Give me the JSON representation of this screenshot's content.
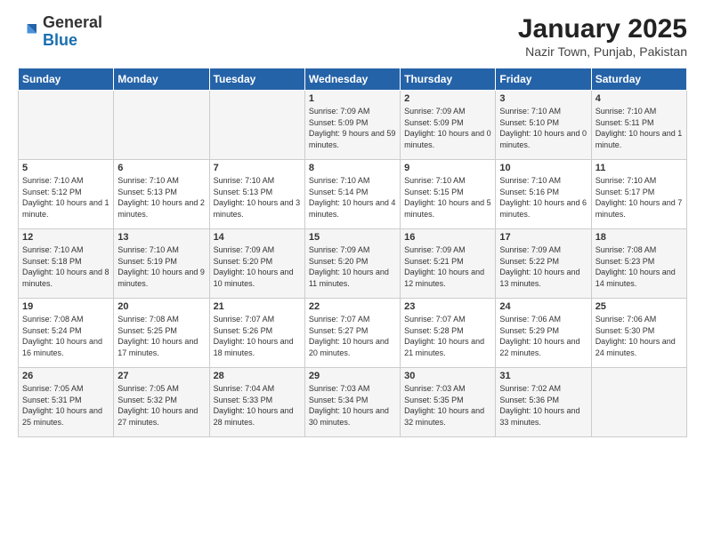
{
  "header": {
    "logo_line1": "General",
    "logo_line2": "Blue",
    "title": "January 2025",
    "subtitle": "Nazir Town, Punjab, Pakistan"
  },
  "days_of_week": [
    "Sunday",
    "Monday",
    "Tuesday",
    "Wednesday",
    "Thursday",
    "Friday",
    "Saturday"
  ],
  "weeks": [
    [
      {
        "day": "",
        "text": ""
      },
      {
        "day": "",
        "text": ""
      },
      {
        "day": "",
        "text": ""
      },
      {
        "day": "1",
        "text": "Sunrise: 7:09 AM\nSunset: 5:09 PM\nDaylight: 9 hours and 59 minutes."
      },
      {
        "day": "2",
        "text": "Sunrise: 7:09 AM\nSunset: 5:09 PM\nDaylight: 10 hours and 0 minutes."
      },
      {
        "day": "3",
        "text": "Sunrise: 7:10 AM\nSunset: 5:10 PM\nDaylight: 10 hours and 0 minutes."
      },
      {
        "day": "4",
        "text": "Sunrise: 7:10 AM\nSunset: 5:11 PM\nDaylight: 10 hours and 1 minute."
      }
    ],
    [
      {
        "day": "5",
        "text": "Sunrise: 7:10 AM\nSunset: 5:12 PM\nDaylight: 10 hours and 1 minute."
      },
      {
        "day": "6",
        "text": "Sunrise: 7:10 AM\nSunset: 5:13 PM\nDaylight: 10 hours and 2 minutes."
      },
      {
        "day": "7",
        "text": "Sunrise: 7:10 AM\nSunset: 5:13 PM\nDaylight: 10 hours and 3 minutes."
      },
      {
        "day": "8",
        "text": "Sunrise: 7:10 AM\nSunset: 5:14 PM\nDaylight: 10 hours and 4 minutes."
      },
      {
        "day": "9",
        "text": "Sunrise: 7:10 AM\nSunset: 5:15 PM\nDaylight: 10 hours and 5 minutes."
      },
      {
        "day": "10",
        "text": "Sunrise: 7:10 AM\nSunset: 5:16 PM\nDaylight: 10 hours and 6 minutes."
      },
      {
        "day": "11",
        "text": "Sunrise: 7:10 AM\nSunset: 5:17 PM\nDaylight: 10 hours and 7 minutes."
      }
    ],
    [
      {
        "day": "12",
        "text": "Sunrise: 7:10 AM\nSunset: 5:18 PM\nDaylight: 10 hours and 8 minutes."
      },
      {
        "day": "13",
        "text": "Sunrise: 7:10 AM\nSunset: 5:19 PM\nDaylight: 10 hours and 9 minutes."
      },
      {
        "day": "14",
        "text": "Sunrise: 7:09 AM\nSunset: 5:20 PM\nDaylight: 10 hours and 10 minutes."
      },
      {
        "day": "15",
        "text": "Sunrise: 7:09 AM\nSunset: 5:20 PM\nDaylight: 10 hours and 11 minutes."
      },
      {
        "day": "16",
        "text": "Sunrise: 7:09 AM\nSunset: 5:21 PM\nDaylight: 10 hours and 12 minutes."
      },
      {
        "day": "17",
        "text": "Sunrise: 7:09 AM\nSunset: 5:22 PM\nDaylight: 10 hours and 13 minutes."
      },
      {
        "day": "18",
        "text": "Sunrise: 7:08 AM\nSunset: 5:23 PM\nDaylight: 10 hours and 14 minutes."
      }
    ],
    [
      {
        "day": "19",
        "text": "Sunrise: 7:08 AM\nSunset: 5:24 PM\nDaylight: 10 hours and 16 minutes."
      },
      {
        "day": "20",
        "text": "Sunrise: 7:08 AM\nSunset: 5:25 PM\nDaylight: 10 hours and 17 minutes."
      },
      {
        "day": "21",
        "text": "Sunrise: 7:07 AM\nSunset: 5:26 PM\nDaylight: 10 hours and 18 minutes."
      },
      {
        "day": "22",
        "text": "Sunrise: 7:07 AM\nSunset: 5:27 PM\nDaylight: 10 hours and 20 minutes."
      },
      {
        "day": "23",
        "text": "Sunrise: 7:07 AM\nSunset: 5:28 PM\nDaylight: 10 hours and 21 minutes."
      },
      {
        "day": "24",
        "text": "Sunrise: 7:06 AM\nSunset: 5:29 PM\nDaylight: 10 hours and 22 minutes."
      },
      {
        "day": "25",
        "text": "Sunrise: 7:06 AM\nSunset: 5:30 PM\nDaylight: 10 hours and 24 minutes."
      }
    ],
    [
      {
        "day": "26",
        "text": "Sunrise: 7:05 AM\nSunset: 5:31 PM\nDaylight: 10 hours and 25 minutes."
      },
      {
        "day": "27",
        "text": "Sunrise: 7:05 AM\nSunset: 5:32 PM\nDaylight: 10 hours and 27 minutes."
      },
      {
        "day": "28",
        "text": "Sunrise: 7:04 AM\nSunset: 5:33 PM\nDaylight: 10 hours and 28 minutes."
      },
      {
        "day": "29",
        "text": "Sunrise: 7:03 AM\nSunset: 5:34 PM\nDaylight: 10 hours and 30 minutes."
      },
      {
        "day": "30",
        "text": "Sunrise: 7:03 AM\nSunset: 5:35 PM\nDaylight: 10 hours and 32 minutes."
      },
      {
        "day": "31",
        "text": "Sunrise: 7:02 AM\nSunset: 5:36 PM\nDaylight: 10 hours and 33 minutes."
      },
      {
        "day": "",
        "text": ""
      }
    ]
  ]
}
